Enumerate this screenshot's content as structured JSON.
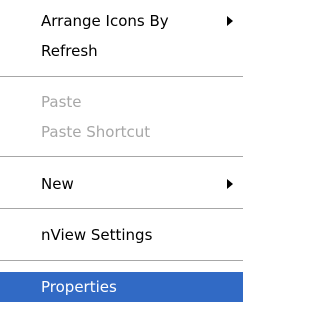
{
  "context_menu": {
    "items": [
      {
        "label": "Arrange Icons By",
        "submenu": true
      },
      {
        "label": "Refresh"
      },
      {
        "label": "Paste",
        "disabled": true
      },
      {
        "label": "Paste Shortcut",
        "disabled": true
      },
      {
        "label": "New",
        "submenu": true
      },
      {
        "label": "nView Settings"
      },
      {
        "label": "Properties",
        "highlighted": true
      }
    ]
  },
  "colors": {
    "highlight": "#316ac5",
    "disabled_text": "#a7a7a7",
    "separator": "#a7a7a7"
  }
}
